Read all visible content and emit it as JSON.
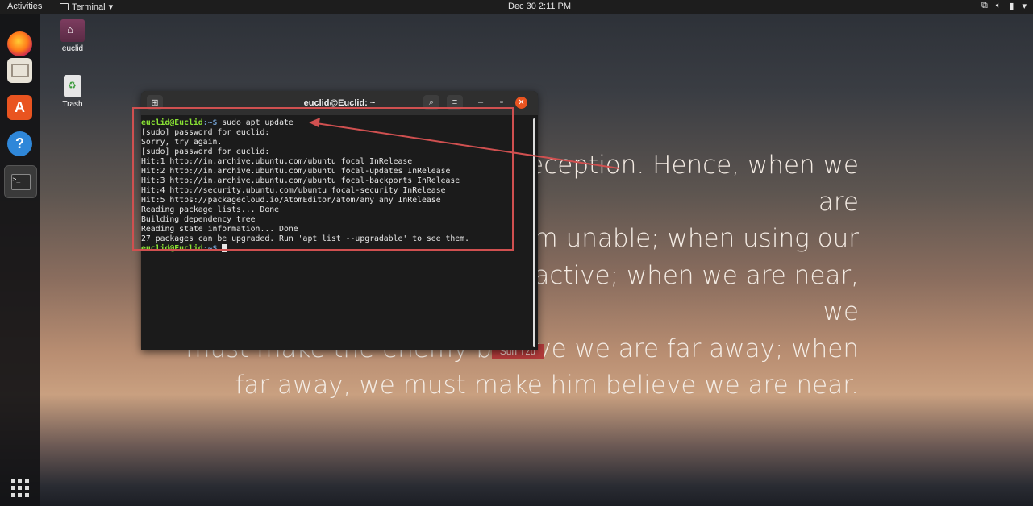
{
  "topbar": {
    "activities": "Activities",
    "app_name": "Terminal",
    "clock": "Dec 30  2:11 PM"
  },
  "desktop": {
    "icons": [
      {
        "label": "euclid"
      },
      {
        "label": "Trash"
      }
    ],
    "quote_lines": [
      "All warfare is based on deception. Hence, when we are",
      "able to attack, we must seem unable; when using our",
      "forces, we must appear inactive; when we are near, we",
      "must make the enemy believe we are far away; when",
      "far away, we must make him believe we are near."
    ],
    "quote_author": "Sun Tzu"
  },
  "terminal": {
    "title": "euclid@Euclid: ~",
    "prompt_user": "euclid@Euclid",
    "prompt_path": ":~$",
    "command": " sudo apt update",
    "output": [
      "[sudo] password for euclid:",
      "Sorry, try again.",
      "[sudo] password for euclid:",
      "Hit:1 http://in.archive.ubuntu.com/ubuntu focal InRelease",
      "Hit:2 http://in.archive.ubuntu.com/ubuntu focal-updates InRelease",
      "Hit:3 http://in.archive.ubuntu.com/ubuntu focal-backports InRelease",
      "Hit:4 http://security.ubuntu.com/ubuntu focal-security InRelease",
      "Hit:5 https://packagecloud.io/AtomEditor/atom/any any InRelease",
      "Reading package lists... Done",
      "Building dependency tree",
      "Reading state information... Done",
      "27 packages can be upgraded. Run 'apt list --upgradable' to see them."
    ]
  },
  "colors": {
    "accent": "#e95420",
    "annotation": "#d05050",
    "prompt_green": "#8ae234",
    "prompt_blue": "#729fcf"
  }
}
